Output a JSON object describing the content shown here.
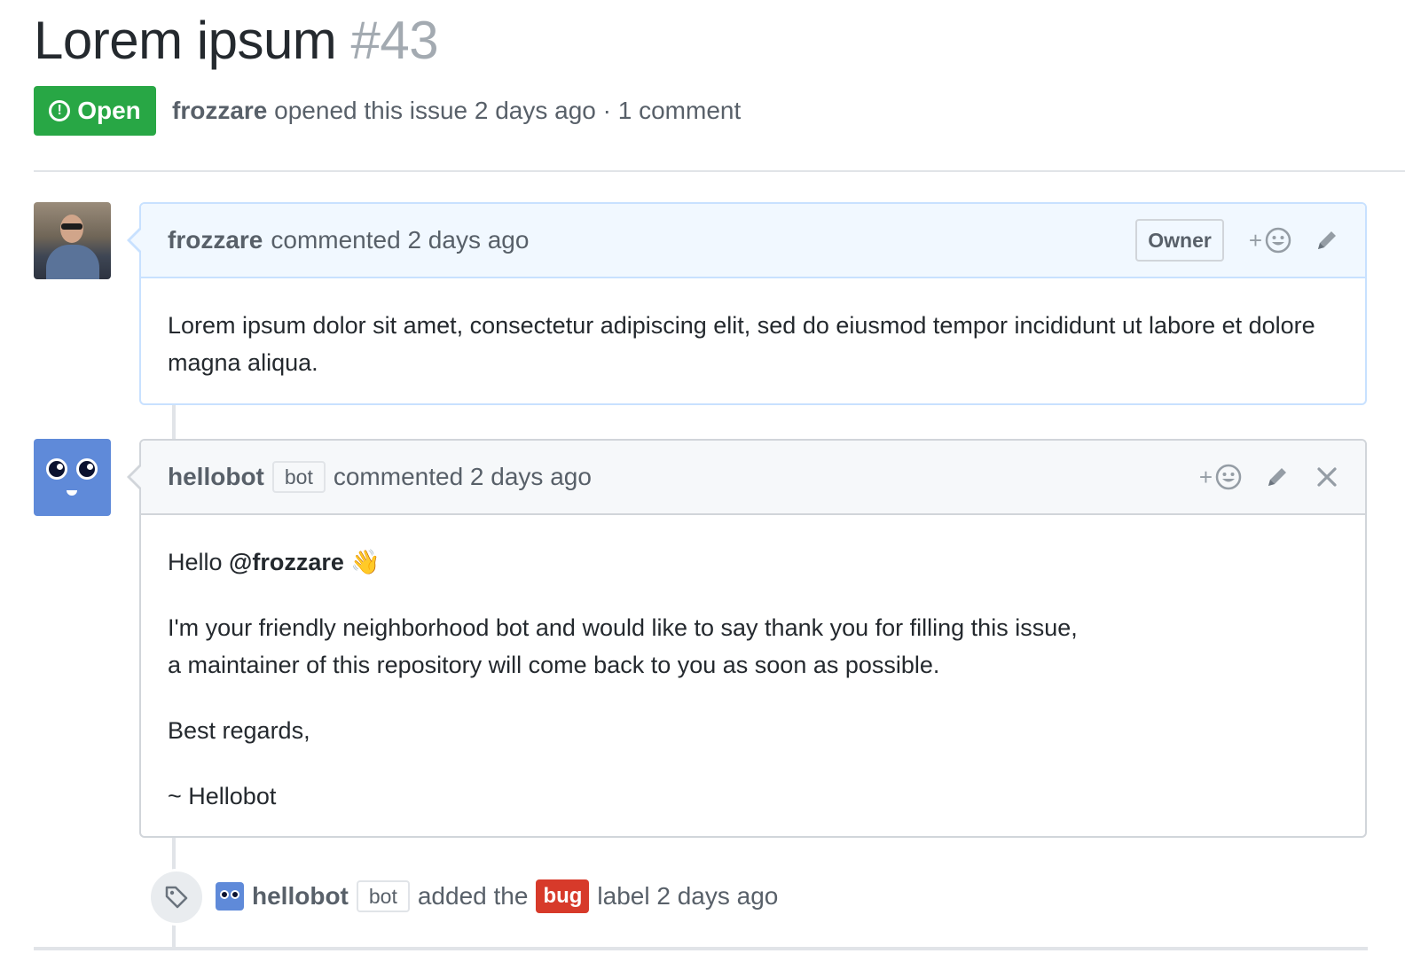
{
  "issue": {
    "title": "Lorem ipsum",
    "number": "#43",
    "state": "Open",
    "author": "frozzare",
    "meta_text": "opened this issue 2 days ago · 1 comment"
  },
  "comments": [
    {
      "author": "frozzare",
      "action": "commented 2 days ago",
      "role_badge": "Owner",
      "react_label": "+",
      "body": "Lorem ipsum dolor sit amet, consectetur adipiscing elit, sed do eiusmod tempor incididunt ut labore et dolore magna aliqua."
    },
    {
      "author": "hellobot",
      "bot_badge": "bot",
      "action": "commented 2 days ago",
      "react_label": "+",
      "greeting": "Hello",
      "mention": "@frozzare",
      "wave_emoji": "👋",
      "line1": "I'm your friendly neighborhood bot and would like to say thank you for filling this issue,",
      "line2": "a maintainer of this repository will come back to you as soon as possible.",
      "regards": "Best regards,",
      "signature": "~ Hellobot"
    }
  ],
  "label_event": {
    "actor": "hellobot",
    "bot_badge": "bot",
    "text_before": "added the",
    "label": "bug",
    "text_after": "label 2 days ago",
    "label_color": "#d73a2a"
  },
  "colors": {
    "open_green": "#28a745",
    "owner_header_bg": "#f1f8ff",
    "owner_border": "#c8e1ff",
    "bot_avatar": "#5f8ad9"
  }
}
